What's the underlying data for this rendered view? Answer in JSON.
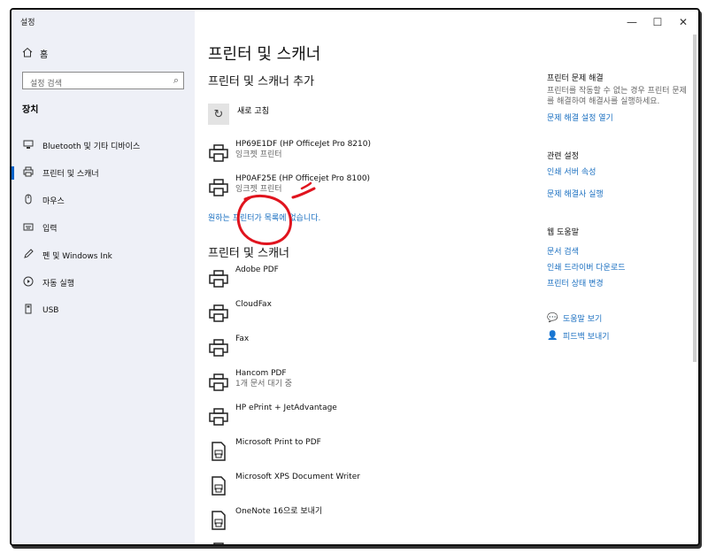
{
  "window": {
    "title": "설정",
    "controls": {
      "minimize": "—",
      "maximize": "☐",
      "close": "✕"
    }
  },
  "sidebar": {
    "home_label": "홈",
    "search_placeholder": "설정 검색",
    "section_label": "장치",
    "items": [
      {
        "label": "Bluetooth 및 기타 디바이스",
        "icon": "bluetooth-devices-icon",
        "active": false
      },
      {
        "label": "프린터 및 스캐너",
        "icon": "printer-icon",
        "active": true
      },
      {
        "label": "마우스",
        "icon": "mouse-icon",
        "active": false
      },
      {
        "label": "입력",
        "icon": "keyboard-icon",
        "active": false
      },
      {
        "label": "펜 및 Windows Ink",
        "icon": "pen-icon",
        "active": false
      },
      {
        "label": "자동 실행",
        "icon": "autoplay-icon",
        "active": false
      },
      {
        "label": "USB",
        "icon": "usb-icon",
        "active": false
      }
    ]
  },
  "main": {
    "page_title": "프린터 및 스캐너",
    "add_section_title": "프린터 및 스캐너 추가",
    "refresh_label": "새로 고침",
    "discovered": [
      {
        "name": "HP69E1DF (HP OfficeJet Pro 8210)",
        "sub": "잉크젯 프린터"
      },
      {
        "name": "HP0AF25E (HP Officejet Pro 8100)",
        "sub": "잉크젯 프린터"
      }
    ],
    "not_listed_link": "원하는 프린터가 목록에 없습니다.",
    "list_title": "프린터 및 스캐너",
    "printers": [
      {
        "name": "Adobe PDF",
        "sub": "",
        "icon": "printer-icon"
      },
      {
        "name": "CloudFax",
        "sub": "",
        "icon": "printer-icon"
      },
      {
        "name": "Fax",
        "sub": "",
        "icon": "printer-icon"
      },
      {
        "name": "Hancom PDF",
        "sub": "1개 문서 대기 중",
        "icon": "printer-icon"
      },
      {
        "name": "HP ePrint + JetAdvantage",
        "sub": "",
        "icon": "printer-icon"
      },
      {
        "name": "Microsoft Print to PDF",
        "sub": "",
        "icon": "document-printer-icon"
      },
      {
        "name": "Microsoft XPS Document Writer",
        "sub": "",
        "icon": "document-printer-icon"
      },
      {
        "name": "OneNote 16으로 보내기",
        "sub": "",
        "icon": "document-printer-icon"
      }
    ]
  },
  "right": {
    "troubleshoot_heading": "프린터 문제 해결",
    "troubleshoot_text": "프린터를 작동할 수 없는 경우 프린터 문제를 해결하여 해결사를 실행하세요.",
    "troubleshoot_link": "문제 해결 설정 열기",
    "related_heading": "관련 설정",
    "related_links": [
      "인쇄 서버 속성",
      "문제 해결사 실행"
    ],
    "web_help_heading": "웹 도움말",
    "web_links": [
      "문서 검색",
      "인쇄 드라이버 다운로드",
      "프린터 상태 변경"
    ],
    "get_help": "도움말 보기",
    "feedback": "피드백 보내기"
  },
  "colors": {
    "accent": "#0a63c9",
    "link": "#1a6fc0",
    "sidebar_bg": "#eef0f7",
    "annotation": "#e0141e"
  }
}
